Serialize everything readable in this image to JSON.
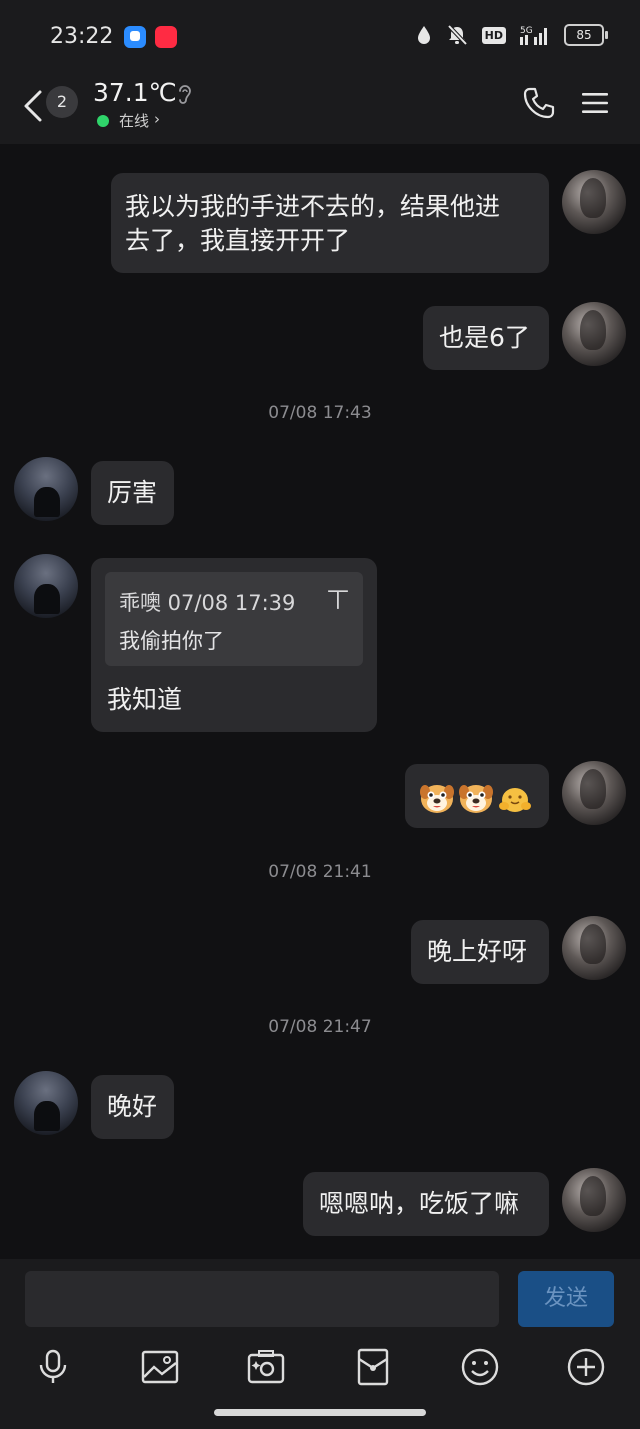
{
  "status_bar": {
    "time": "23:22",
    "hd": "HD",
    "network": "5G",
    "battery": "85"
  },
  "header": {
    "unread_count": "2",
    "title": "37.1℃",
    "presence": "在线",
    "icons": [
      "back-arrow-icon",
      "ear-icon",
      "phone-icon",
      "menu-icon"
    ]
  },
  "messages": [
    {
      "side": "right",
      "text": "我以为我的手进不去的，结果他进",
      "text2": "去了，我直接开开了"
    },
    {
      "side": "right",
      "text": "也是6了"
    },
    {
      "type": "time",
      "text": "07/08 17:43"
    },
    {
      "side": "left",
      "text": "厉害"
    },
    {
      "side": "left",
      "quote_header": "乖噢 07/08 17:39",
      "quote_pin": "丅",
      "quote_text": "我偷拍你了",
      "text": "我知道"
    },
    {
      "side": "right",
      "emojis": [
        "dog-face-emoji",
        "dog-face-emoji",
        "hug-emoji"
      ]
    },
    {
      "type": "time",
      "text": "07/08 21:41"
    },
    {
      "side": "right",
      "text": "晚上好呀"
    },
    {
      "type": "time",
      "text": "07/08 21:47"
    },
    {
      "side": "left",
      "text": "晚好"
    },
    {
      "side": "right",
      "text": "嗯嗯呐，吃饭了嘛"
    }
  ],
  "input": {
    "value": "",
    "send_label": "发送"
  },
  "toolbar": {
    "tools": [
      "microphone-icon",
      "image-icon",
      "camera-icon",
      "red-packet-icon",
      "emoji-icon",
      "plus-icon"
    ]
  },
  "colors": {
    "background": "#111113",
    "bubble": "#2b2b2e",
    "online": "#2fd46a",
    "send_button": "#1a4f86"
  }
}
